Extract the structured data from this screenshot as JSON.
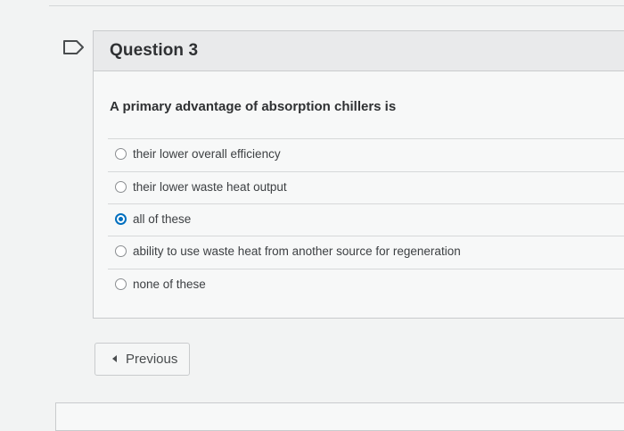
{
  "question": {
    "title": "Question 3",
    "prompt": "A primary advantage of absorption chillers is",
    "options": [
      {
        "label": "their lower overall efficiency",
        "selected": false
      },
      {
        "label": "their lower waste heat output",
        "selected": false
      },
      {
        "label": "all of these",
        "selected": true
      },
      {
        "label": "ability to use waste heat from another source for regeneration",
        "selected": false
      },
      {
        "label": "none of these",
        "selected": false
      }
    ],
    "bookmark_icon": "bookmark-icon"
  },
  "navigation": {
    "previous_label": "Previous",
    "previous_icon": "triangle-left-icon"
  },
  "colors": {
    "accent": "#006fbf",
    "header_bg": "#e9eaeb",
    "page_bg": "#f2f3f3"
  }
}
